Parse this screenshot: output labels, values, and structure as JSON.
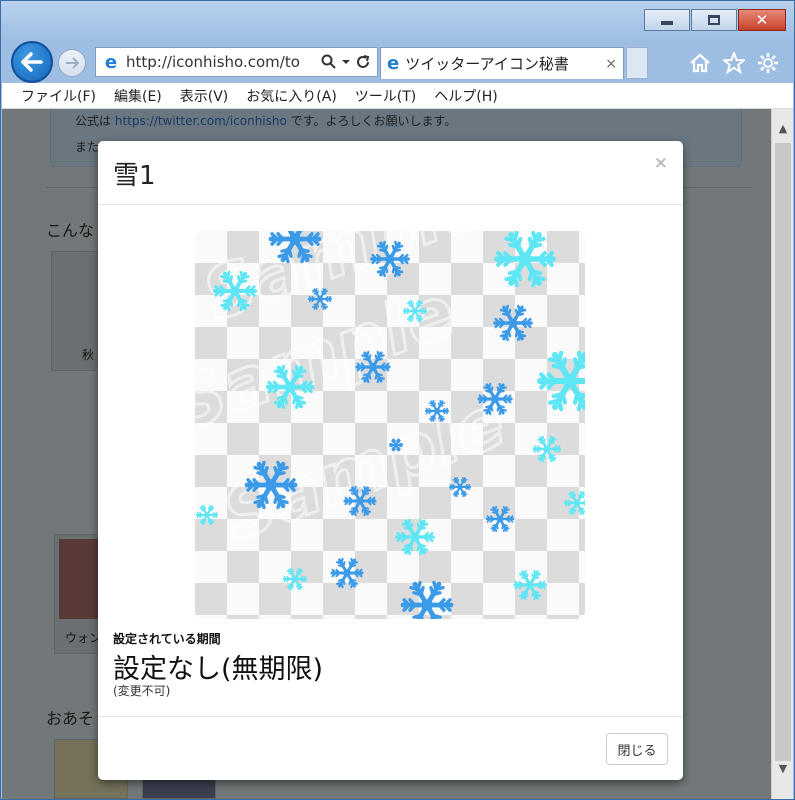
{
  "browser": {
    "address_url": "http://iconhisho.com/to",
    "tab_title": "ツイッターアイコン秘書",
    "tab_close": "×",
    "caption_close": "✕"
  },
  "menu": [
    "ファイル(F)",
    "編集(E)",
    "表示(V)",
    "お気に入り(A)",
    "ツール(T)",
    "ヘルプ(H)"
  ],
  "page": {
    "info_line1_prefix": "公式は",
    "info_line1_link": "https://twitter.com/iconhisho",
    "info_line1_suffix": "です。よろしくお願いします。",
    "info_line2": "また",
    "section1_heading": "こんな",
    "card1_label": "秋",
    "card2_label": "ウォン",
    "section2_heading": "おあそ"
  },
  "modal": {
    "title": "雪1",
    "close_x": "×",
    "period_label": "設定されている期間",
    "period_value": "設定なし(無期限)",
    "period_note": "(変更不可)",
    "close_button": "閉じる",
    "watermark": "Sample"
  },
  "colors": {
    "snow_light": "#5fe6f5",
    "snow_blue": "#3c9be8",
    "overlay_bg": "#727879"
  }
}
